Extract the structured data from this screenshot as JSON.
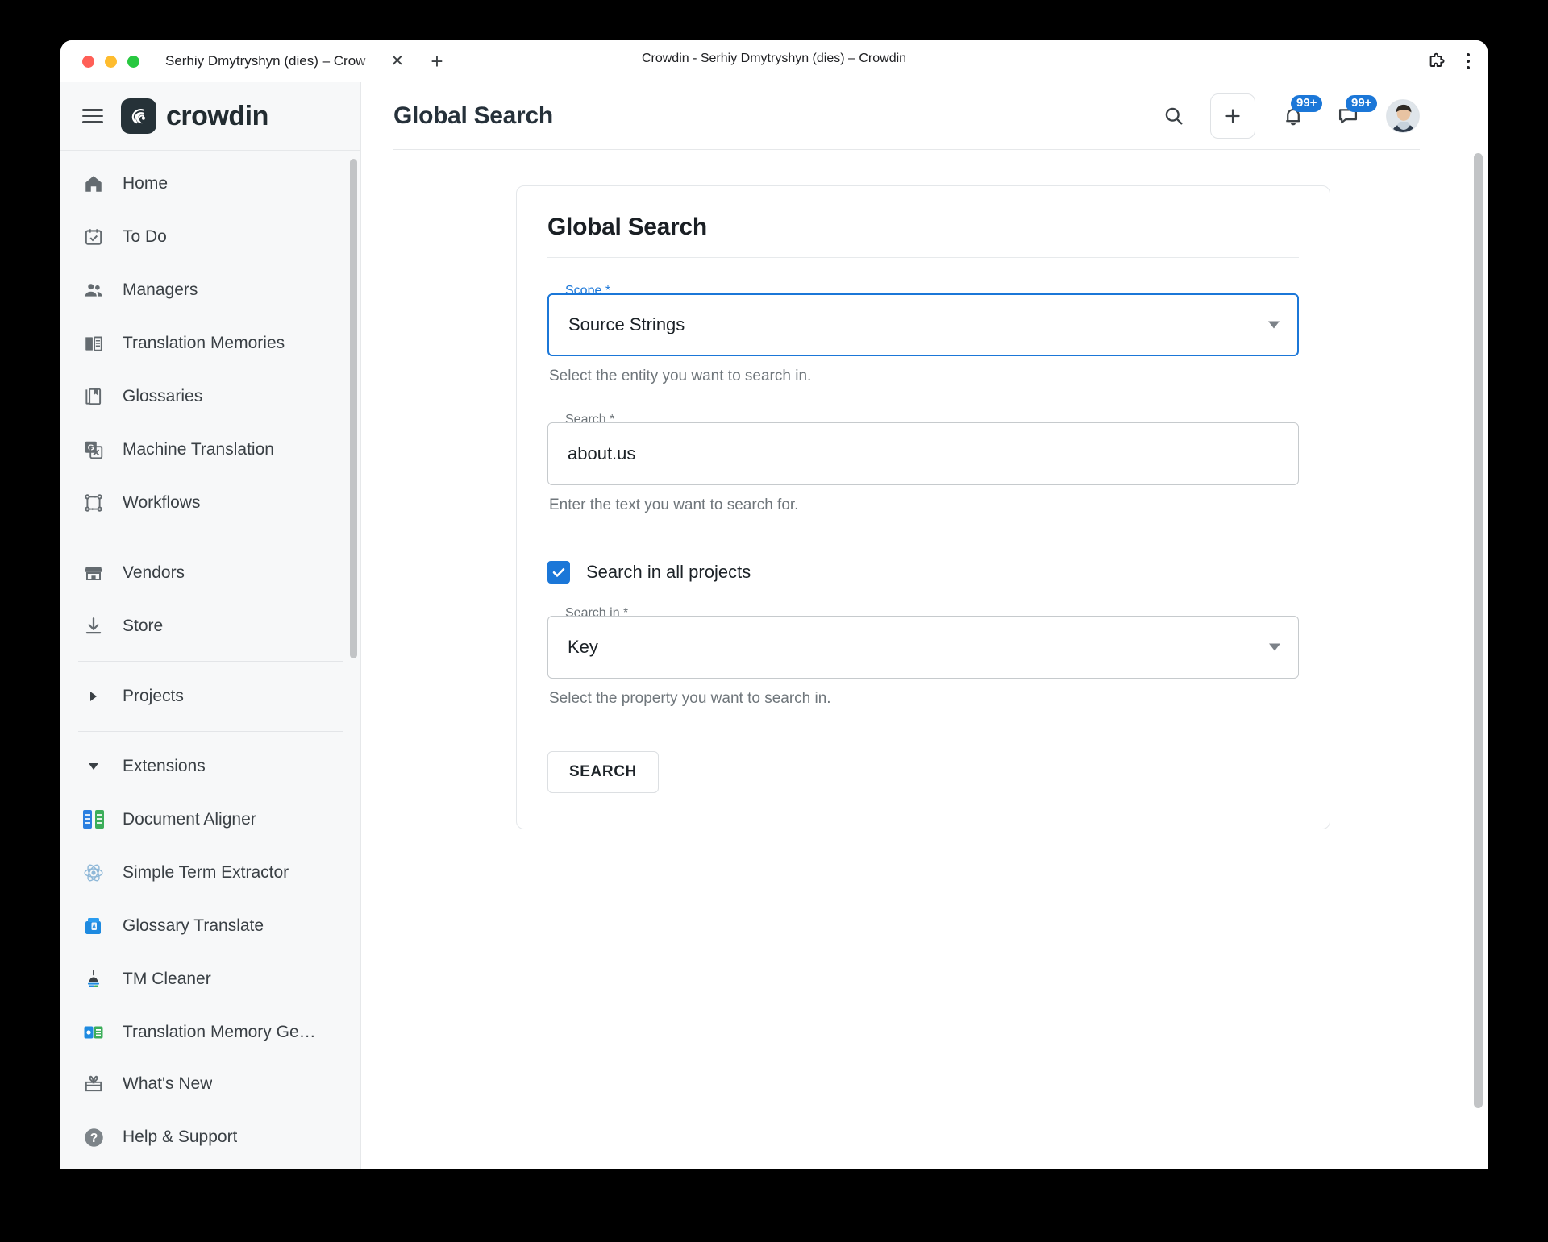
{
  "browser": {
    "tab_title": "Serhiy Dmytryshyn (dies) – Crow",
    "window_title": "Crowdin - Serhiy Dmytryshyn (dies) – Crowdin",
    "close_tab_label": "✕",
    "new_tab_label": "+",
    "extensions_icon": "puzzle-icon",
    "menu_icon": "kebab-menu-icon"
  },
  "sidebar": {
    "brand": "crowdin",
    "menu_icon": "hamburger-icon",
    "items": [
      {
        "label": "Home",
        "icon": "home-icon"
      },
      {
        "label": "To Do",
        "icon": "calendar-check-icon"
      },
      {
        "label": "Managers",
        "icon": "people-icon"
      },
      {
        "label": "Translation Memories",
        "icon": "open-book-icon"
      },
      {
        "label": "Glossaries",
        "icon": "books-bookmark-icon"
      },
      {
        "label": "Machine Translation",
        "icon": "translate-icon"
      },
      {
        "label": "Workflows",
        "icon": "workflow-icon"
      }
    ],
    "items2": [
      {
        "label": "Vendors",
        "icon": "store-icon"
      },
      {
        "label": "Store",
        "icon": "download-icon"
      }
    ],
    "groups": {
      "projects": {
        "label": "Projects",
        "expanded": false,
        "caret": "chevron-right-icon"
      },
      "extensions": {
        "label": "Extensions",
        "expanded": true,
        "caret": "chevron-down-icon"
      }
    },
    "extensions": [
      {
        "label": "Document Aligner",
        "icon": "document-aligner-icon"
      },
      {
        "label": "Simple Term Extractor",
        "icon": "atom-icon"
      },
      {
        "label": "Glossary Translate",
        "icon": "glossary-translate-icon"
      },
      {
        "label": "TM Cleaner",
        "icon": "broom-icon"
      },
      {
        "label": "Translation Memory Ge…",
        "icon": "tm-generator-icon"
      }
    ],
    "footer": [
      {
        "label": "What's New",
        "icon": "gift-icon"
      },
      {
        "label": "Help & Support",
        "icon": "question-circle-icon"
      }
    ]
  },
  "topbar": {
    "title": "Global Search",
    "search_icon": "search-icon",
    "add_icon": "plus-icon",
    "notifications": {
      "icon": "bell-icon",
      "badge": "99+"
    },
    "messages": {
      "icon": "chat-bubble-icon",
      "badge": "99+"
    },
    "avatar": "user-avatar"
  },
  "form": {
    "card_title": "Global Search",
    "scope": {
      "legend": "Scope *",
      "value": "Source Strings",
      "helper": "Select the entity you want to search in.",
      "focused": true
    },
    "search": {
      "legend": "Search *",
      "value": "about.us",
      "placeholder": "",
      "helper": "Enter the text you want to search for."
    },
    "all_projects": {
      "label": "Search in all projects",
      "checked": true
    },
    "search_in": {
      "legend": "Search in *",
      "value": "Key",
      "helper": "Select the property you want to search in."
    },
    "submit_label": "SEARCH"
  },
  "colors": {
    "accent": "#1b77d8",
    "sidebar_bg": "#f7f8f9",
    "text": "#3a4045"
  }
}
